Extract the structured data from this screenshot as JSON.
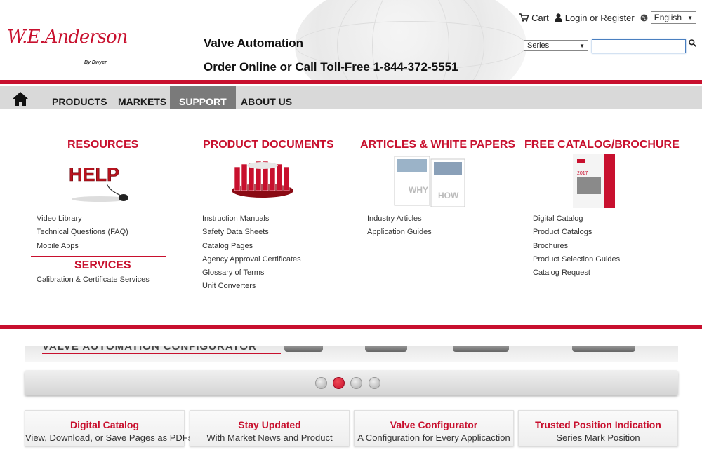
{
  "brand": {
    "logo_script": "W.E.Anderson",
    "logo_byline": "By Dwyer"
  },
  "header": {
    "tagline": "Valve Automation",
    "phone": "Order Online or Call Toll-Free 1-844-372-5551",
    "cart_label": "Cart",
    "login_label": "Login or Register",
    "language_selected": "English",
    "series_selected": "Series",
    "search_value": ""
  },
  "nav": {
    "items": [
      {
        "label": "PRODUCTS"
      },
      {
        "label": "MARKETS"
      },
      {
        "label": "SUPPORT"
      },
      {
        "label": "ABOUT US"
      }
    ],
    "active": "SUPPORT"
  },
  "menu": {
    "resources": {
      "title": "RESOURCES",
      "links": [
        "Video Library",
        "Technical Questions (FAQ)",
        "Mobile Apps"
      ]
    },
    "services": {
      "title": "SERVICES",
      "links": [
        "Calibration & Certificate Services"
      ]
    },
    "product_documents": {
      "title": "PRODUCT DOCUMENTS",
      "links": [
        "Instruction Manuals",
        "Safety Data Sheets",
        "Catalog Pages",
        "Agency Approval Certificates",
        "Glossary of Terms",
        "Unit Converters"
      ]
    },
    "articles": {
      "title": "ARTICLES & WHITE PAPERS",
      "links": [
        "Industry Articles",
        "Application Guides"
      ]
    },
    "catalog": {
      "title": "FREE CATALOG/BROCHURE",
      "links": [
        "Digital Catalog",
        "Product Catalogs",
        "Brochures",
        "Product Selection Guides",
        "Catalog Request"
      ]
    },
    "images": {
      "help_text": "HELP",
      "why_text": "WHY",
      "how_text": "HOW",
      "catalog_year": "2017"
    }
  },
  "slider": {
    "banner_text": "VALVE AUTOMATION CONFIGURATOR",
    "slide_count": 4,
    "active_slide": 2
  },
  "features": [
    {
      "title": "Digital Catalog",
      "subtitle": "View, Download, or Save Pages as PDFs"
    },
    {
      "title": "Stay Updated",
      "subtitle": "With Market News and Product"
    },
    {
      "title": "Valve Configurator",
      "subtitle": "A Configuration for Every Applicaction"
    },
    {
      "title": "Trusted Position Indication",
      "subtitle": "Series Mark Position"
    }
  ],
  "colors": {
    "brand_red": "#c8102e",
    "nav_gray": "#d9d9d9",
    "nav_active": "#7a7a7a"
  },
  "icons": [
    "cart-icon",
    "user-icon",
    "globe-icon",
    "search-icon",
    "home-icon"
  ]
}
